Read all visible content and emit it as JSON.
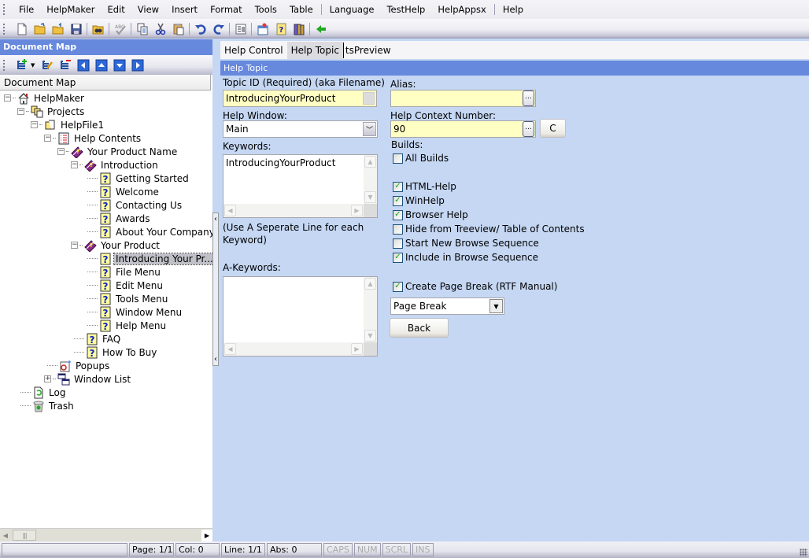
{
  "menubar": {
    "items": [
      "File",
      "HelpMaker",
      "Edit",
      "View",
      "Insert",
      "Format",
      "Tools",
      "Table",
      "Language",
      "TestHelp",
      "HelpAppsx",
      "Help"
    ]
  },
  "toolbar": {
    "buttons": [
      "new-document",
      "open-folder",
      "open-project",
      "save",
      "find",
      "spell-check",
      "copy",
      "cut",
      "paste",
      "undo",
      "redo",
      "paragraph",
      "topic-properties",
      "help-context",
      "books",
      "back-arrow"
    ]
  },
  "document_map": {
    "title": "Document Map",
    "header": "Document Map",
    "tree": [
      {
        "label": "HelpMaker",
        "icon": "home-icon",
        "level": 0,
        "expander": "-"
      },
      {
        "label": "Projects",
        "icon": "projects-icon",
        "level": 1,
        "expander": "-"
      },
      {
        "label": "HelpFile1",
        "icon": "helpfile-icon",
        "level": 2,
        "expander": "-"
      },
      {
        "label": "Help Contents",
        "icon": "contents-icon",
        "level": 3,
        "expander": "-"
      },
      {
        "label": "Your Product Name",
        "icon": "book-icon",
        "level": 4,
        "expander": "-"
      },
      {
        "label": "Introduction",
        "icon": "book-icon",
        "level": 5,
        "expander": "-"
      },
      {
        "label": "Getting Started",
        "icon": "topic-icon",
        "level": 6
      },
      {
        "label": "Welcome",
        "icon": "topic-icon",
        "level": 6
      },
      {
        "label": "Contacting Us",
        "icon": "topic-icon",
        "level": 6
      },
      {
        "label": "Awards",
        "icon": "topic-icon",
        "level": 6
      },
      {
        "label": "About Your Company",
        "icon": "topic-icon",
        "level": 6
      },
      {
        "label": "Your Product",
        "icon": "book-icon",
        "level": 5,
        "expander": "-"
      },
      {
        "label": "Introducing Your Pr...",
        "icon": "topic-icon",
        "level": 6,
        "selected": true
      },
      {
        "label": "File Menu",
        "icon": "topic-icon",
        "level": 6
      },
      {
        "label": "Edit Menu",
        "icon": "topic-icon",
        "level": 6
      },
      {
        "label": "Tools Menu",
        "icon": "topic-icon",
        "level": 6
      },
      {
        "label": "Window Menu",
        "icon": "topic-icon",
        "level": 6
      },
      {
        "label": "Help Menu",
        "icon": "topic-icon",
        "level": 6
      },
      {
        "label": "FAQ",
        "icon": "topic-icon",
        "level": 5
      },
      {
        "label": "How To Buy",
        "icon": "topic-icon",
        "level": 5
      },
      {
        "label": "Popups",
        "icon": "popups-icon",
        "level": 3
      },
      {
        "label": "Window List",
        "icon": "window-list-icon",
        "level": 3,
        "expander": "+"
      },
      {
        "label": "Log",
        "icon": "log-icon",
        "level": 1
      },
      {
        "label": "Trash",
        "icon": "trash-icon",
        "level": 1
      }
    ]
  },
  "tabs": [
    {
      "label": "Help Control",
      "active": false
    },
    {
      "label": "Help Topic",
      "active": true
    },
    {
      "label": "tsPreview",
      "active": false
    }
  ],
  "panel": {
    "title": "Help Topic",
    "topic_id_label": "Topic ID (Required) (aka Filename)",
    "topic_id_value": "IntroducingYourProduct",
    "alias_label": "Alias:",
    "alias_value": "",
    "help_window_label": "Help Window:",
    "help_window_value": "Main",
    "help_context_label": "Help Context Number:",
    "help_context_value": "90",
    "context_button": "C",
    "keywords_label": "Keywords:",
    "keywords_value": "IntroducingYourProduct",
    "keywords_hint": "(Use A Seperate Line for each Keyword)",
    "akeywords_label": "A-Keywords:",
    "akeywords_value": "",
    "builds_label": "Builds:",
    "checkboxes": [
      {
        "label": "All Builds",
        "checked": false
      },
      {
        "label": "HTML-Help",
        "checked": true
      },
      {
        "label": "WinHelp",
        "checked": true
      },
      {
        "label": "Browser Help",
        "checked": true
      },
      {
        "label": "Hide from Treeview/ Table of Contents",
        "checked": false
      },
      {
        "label": "Start New Browse Sequence",
        "checked": false
      },
      {
        "label": "Include in Browse Sequence",
        "checked": true
      },
      {
        "label": "Create Page Break (RTF Manual)",
        "checked": true
      }
    ],
    "page_break_value": "Page Break",
    "back_button": "Back",
    "ellipsis": "..."
  },
  "statusbar": {
    "page": "Page: 1/1",
    "col": "Col: 0",
    "line": "Line: 1/1",
    "abs": "Abs: 0",
    "caps": "CAPS",
    "num": "NUM",
    "scrl": "SCRL",
    "ins": "INS"
  },
  "colors": {
    "title_bar_blue": "#6688dd",
    "panel_background": "#c5d7f3",
    "field_yellow": "#ffffc4",
    "check_green": "#21a121"
  }
}
